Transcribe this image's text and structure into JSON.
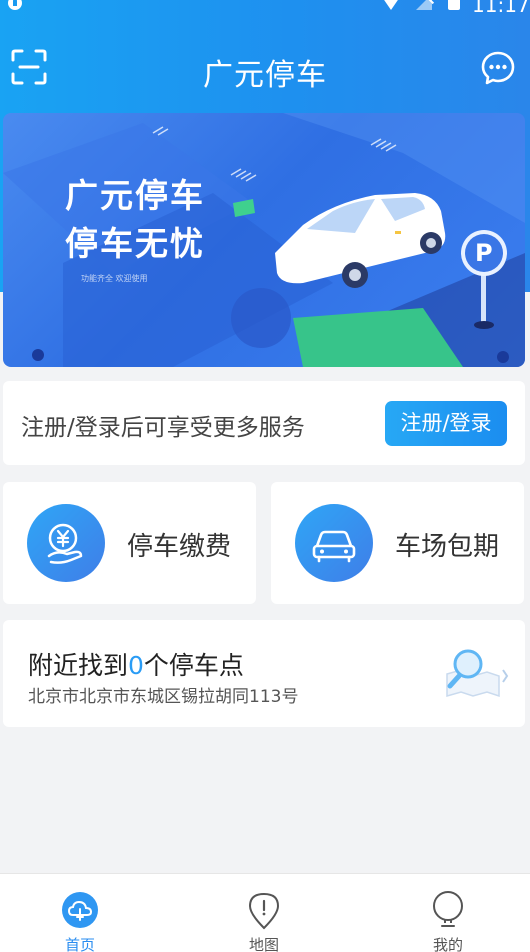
{
  "status_bar": {
    "time": "11:17"
  },
  "header": {
    "title": "广元停车"
  },
  "banner": {
    "line1": "广元停车",
    "line2": "停车无忧",
    "subtitle": "功能齐全 欢迎使用",
    "sign_letter": "P"
  },
  "register": {
    "prompt": "注册/登录后可享受更多服务",
    "button_label": "注册/登录"
  },
  "services": [
    {
      "label": "停车缴费",
      "icon": "yen-hand-icon"
    },
    {
      "label": "车场包期",
      "icon": "car-icon"
    }
  ],
  "nearby": {
    "title_prefix": "附近找到",
    "count": "0",
    "title_suffix": "个停车点",
    "address": "北京市北京市东城区锡拉胡同113号"
  },
  "bottom_nav": [
    {
      "label": "首页",
      "icon": "home-cloud-icon",
      "active": true
    },
    {
      "label": "地图",
      "icon": "map-pin-icon",
      "active": false
    },
    {
      "label": "我的",
      "icon": "bulb-user-icon",
      "active": false
    }
  ],
  "colors": {
    "primary": "#1e90ef",
    "accent": "#2a9cf5",
    "background": "#f2f3f5"
  }
}
